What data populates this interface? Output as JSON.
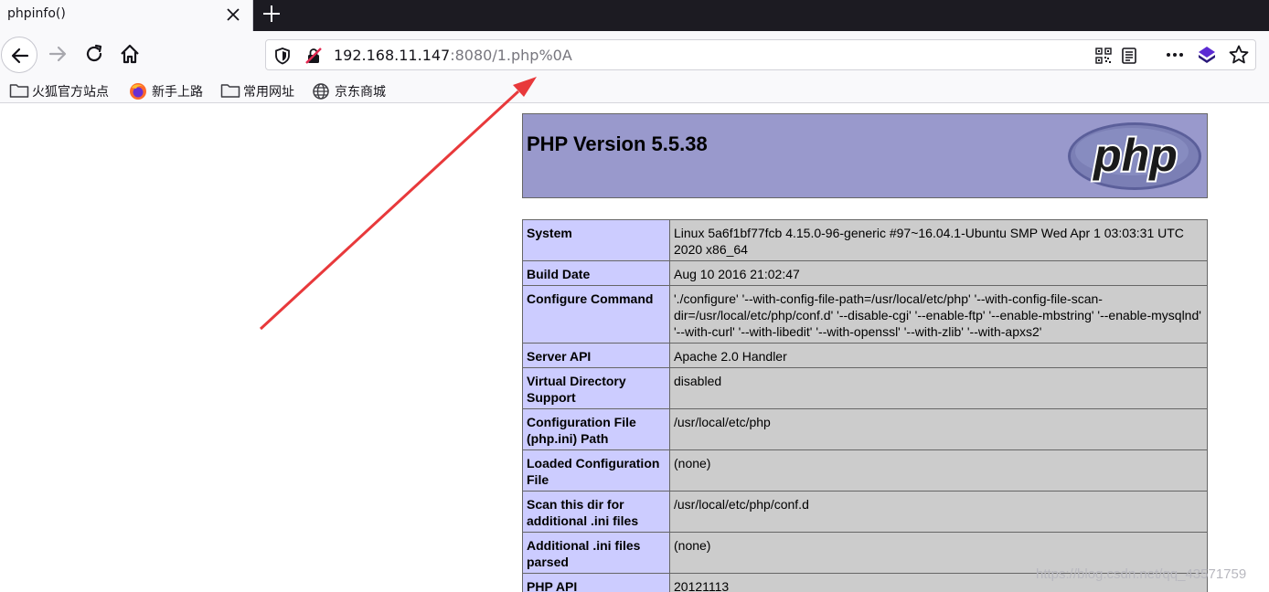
{
  "tab": {
    "title": "phpinfo()"
  },
  "urlbar": {
    "host": "192.168.11.147",
    "rest": ":8080/1.php%0A"
  },
  "bookmarks": [
    {
      "label": "火狐官方站点",
      "icon": "folder-icon"
    },
    {
      "label": "新手上路",
      "icon": "firefox-icon"
    },
    {
      "label": "常用网址",
      "icon": "folder-icon"
    },
    {
      "label": "京东商城",
      "icon": "globe-icon"
    }
  ],
  "page": {
    "version_title": "PHP Version 5.5.38",
    "logo_text": "php",
    "rows": [
      {
        "label": "System",
        "value": "Linux 5a6f1bf77fcb 4.15.0-96-generic #97~16.04.1-Ubuntu SMP Wed Apr 1 03:03:31 UTC 2020 x86_64"
      },
      {
        "label": "Build Date",
        "value": "Aug 10 2016 21:02:47"
      },
      {
        "label": "Configure Command",
        "value": "'./configure' '--with-config-file-path=/usr/local/etc/php' '--with-config-file-scan-dir=/usr/local/etc/php/conf.d' '--disable-cgi' '--enable-ftp' '--enable-mbstring' '--enable-mysqlnd' '--with-curl' '--with-libedit' '--with-openssl' '--with-zlib' '--with-apxs2'"
      },
      {
        "label": "Server API",
        "value": "Apache 2.0 Handler"
      },
      {
        "label": "Virtual Directory Support",
        "value": "disabled"
      },
      {
        "label": "Configuration File (php.ini) Path",
        "value": "/usr/local/etc/php"
      },
      {
        "label": "Loaded Configuration File",
        "value": "(none)"
      },
      {
        "label": "Scan this dir for additional .ini files",
        "value": "/usr/local/etc/php/conf.d"
      },
      {
        "label": "Additional .ini files parsed",
        "value": "(none)"
      },
      {
        "label": "PHP API",
        "value": "20121113"
      }
    ]
  },
  "watermark": "https://blog.csdn.net/qq_43571759",
  "colors": {
    "header_bg": "#9999cc",
    "label_bg": "#ccccff",
    "value_bg": "#cccccc",
    "arrow": "#e8393b"
  }
}
